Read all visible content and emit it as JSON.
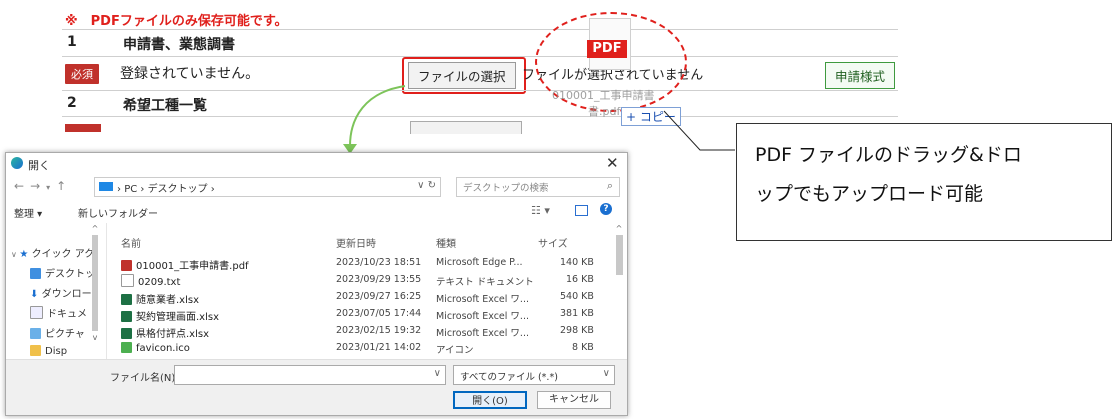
{
  "form": {
    "notice": "※　PDFファイルのみ保存可能です。",
    "row1": {
      "num": "1",
      "title": "申請書、業態調書",
      "required": "必須",
      "status": "登録されていません。",
      "choose_button": "ファイルの選択",
      "no_file": "ファイルが選択されていません",
      "template_button": "申請様式"
    },
    "row2": {
      "num": "2",
      "title": "希望工種一覧"
    }
  },
  "drag": {
    "pdf_label": "PDF",
    "ghost_name": "010001_工事申請書",
    "ghost_name2": "書.pdf",
    "copy_label": "+ コピー"
  },
  "callout": {
    "line1": "PDF ファイルのドラッグ&ドロ",
    "line2": "ップでもアップロード可能"
  },
  "dialog": {
    "title": "開く",
    "breadcrumb": [
      "PC",
      "デスクトップ"
    ],
    "search_placeholder": "デスクトップの検索",
    "organize": "整理 ▾",
    "new_folder": "新しいフォルダー",
    "nav_items": [
      "クイック アク",
      "デスクトッ",
      "ダウンロー",
      "ドキュメ",
      "ピクチャ",
      "Disp"
    ],
    "columns": {
      "name": "名前",
      "date": "更新日時",
      "type": "種類",
      "size": "サイズ"
    },
    "files": [
      {
        "name": "010001_工事申請書.pdf",
        "date": "2023/10/23 18:51",
        "type": "Microsoft Edge P...",
        "size": "140 KB",
        "icon": "pdf-icon"
      },
      {
        "name": "0209.txt",
        "date": "2023/09/29 13:55",
        "type": "テキスト ドキュメント",
        "size": "16 KB",
        "icon": "text-file-icon"
      },
      {
        "name": "随意業者.xlsx",
        "date": "2023/09/27 16:25",
        "type": "Microsoft Excel ワ...",
        "size": "540 KB",
        "icon": "excel-icon"
      },
      {
        "name": "契約管理画面.xlsx",
        "date": "2023/07/05 17:44",
        "type": "Microsoft Excel ワ...",
        "size": "381 KB",
        "icon": "excel-icon"
      },
      {
        "name": "県格付評点.xlsx",
        "date": "2023/02/15 19:32",
        "type": "Microsoft Excel ワ...",
        "size": "298 KB",
        "icon": "excel-icon"
      },
      {
        "name": "favicon.ico",
        "date": "2023/01/21 14:02",
        "type": "アイコン",
        "size": "8 KB",
        "icon": "ico-icon"
      }
    ],
    "filename_label": "ファイル名(N):",
    "filetype": "すべてのファイル (*.*)",
    "open_button": "開く(O)",
    "cancel_button": "キャンセル",
    "colors": {
      "pdf": "#c0312b",
      "excel": "#1d7044",
      "folder": "#f0c04a",
      "accent": "#0067c0"
    }
  }
}
